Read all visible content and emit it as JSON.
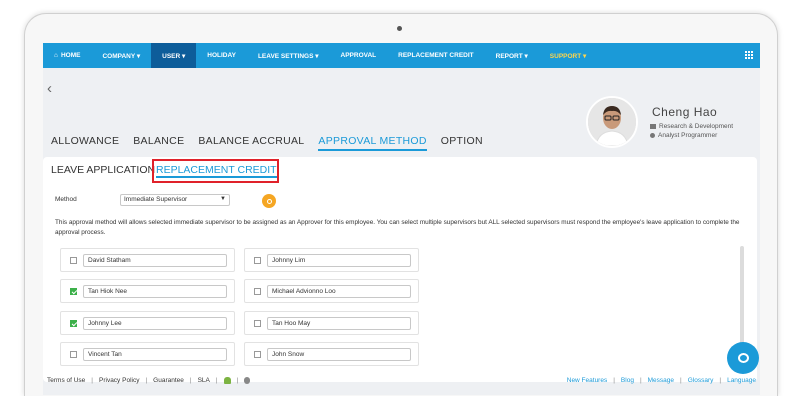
{
  "nav": {
    "items": [
      {
        "label": "HOME"
      },
      {
        "label": "COMPANY ▾"
      },
      {
        "label": "USER ▾"
      },
      {
        "label": "HOLIDAY"
      },
      {
        "label": "LEAVE SETTINGS ▾"
      },
      {
        "label": "APPROVAL"
      },
      {
        "label": "REPLACEMENT CREDIT"
      },
      {
        "label": "REPORT ▾"
      },
      {
        "label": "SUPPORT ▾"
      }
    ],
    "active_index": 2,
    "home_icon": "home-icon",
    "apps_icon": "grid-icon"
  },
  "profile": {
    "name": "Cheng Hao",
    "department": "Research & Development",
    "position": "Analyst Programmer"
  },
  "main_tabs": [
    {
      "label": "ALLOWANCE"
    },
    {
      "label": "BALANCE"
    },
    {
      "label": "BALANCE ACCRUAL"
    },
    {
      "label": "APPROVAL METHOD"
    },
    {
      "label": "OPTION"
    }
  ],
  "sub_tabs": {
    "leave_application": "LEAVE APPLICATION",
    "replacement_credit": "REPLACEMENT CREDIT"
  },
  "method": {
    "label": "Method",
    "value": "Immediate Supervisor"
  },
  "description": "This approval method will allows selected immediate supervisor to be assigned as an Approver for this employee. You can select multiple supervisors but ALL selected supervisors must respond the employee's leave application to complete the approval process.",
  "employees": [
    {
      "name": "David Statham",
      "checked": false
    },
    {
      "name": "Johnny Lim",
      "checked": false
    },
    {
      "name": "Tan Hiok Nee",
      "checked": true
    },
    {
      "name": "Michael Advionno Loo",
      "checked": false
    },
    {
      "name": "Johnny Lee",
      "checked": true
    },
    {
      "name": "Tan Hoo May",
      "checked": false
    },
    {
      "name": "Vincent Tan",
      "checked": false
    },
    {
      "name": "John Snow",
      "checked": false
    }
  ],
  "footer": {
    "left": [
      "Terms of Use",
      "Privacy Policy",
      "Guarantee",
      "SLA"
    ],
    "right": [
      "New Features",
      "Blog",
      "Message",
      "Glossary",
      "Language"
    ]
  },
  "colors": {
    "accent": "#1b9ad8",
    "nav_active": "#0d5d9a",
    "highlight_box": "#e0212a",
    "help_button": "#f5a623",
    "checkbox_on": "#3cb04a"
  }
}
